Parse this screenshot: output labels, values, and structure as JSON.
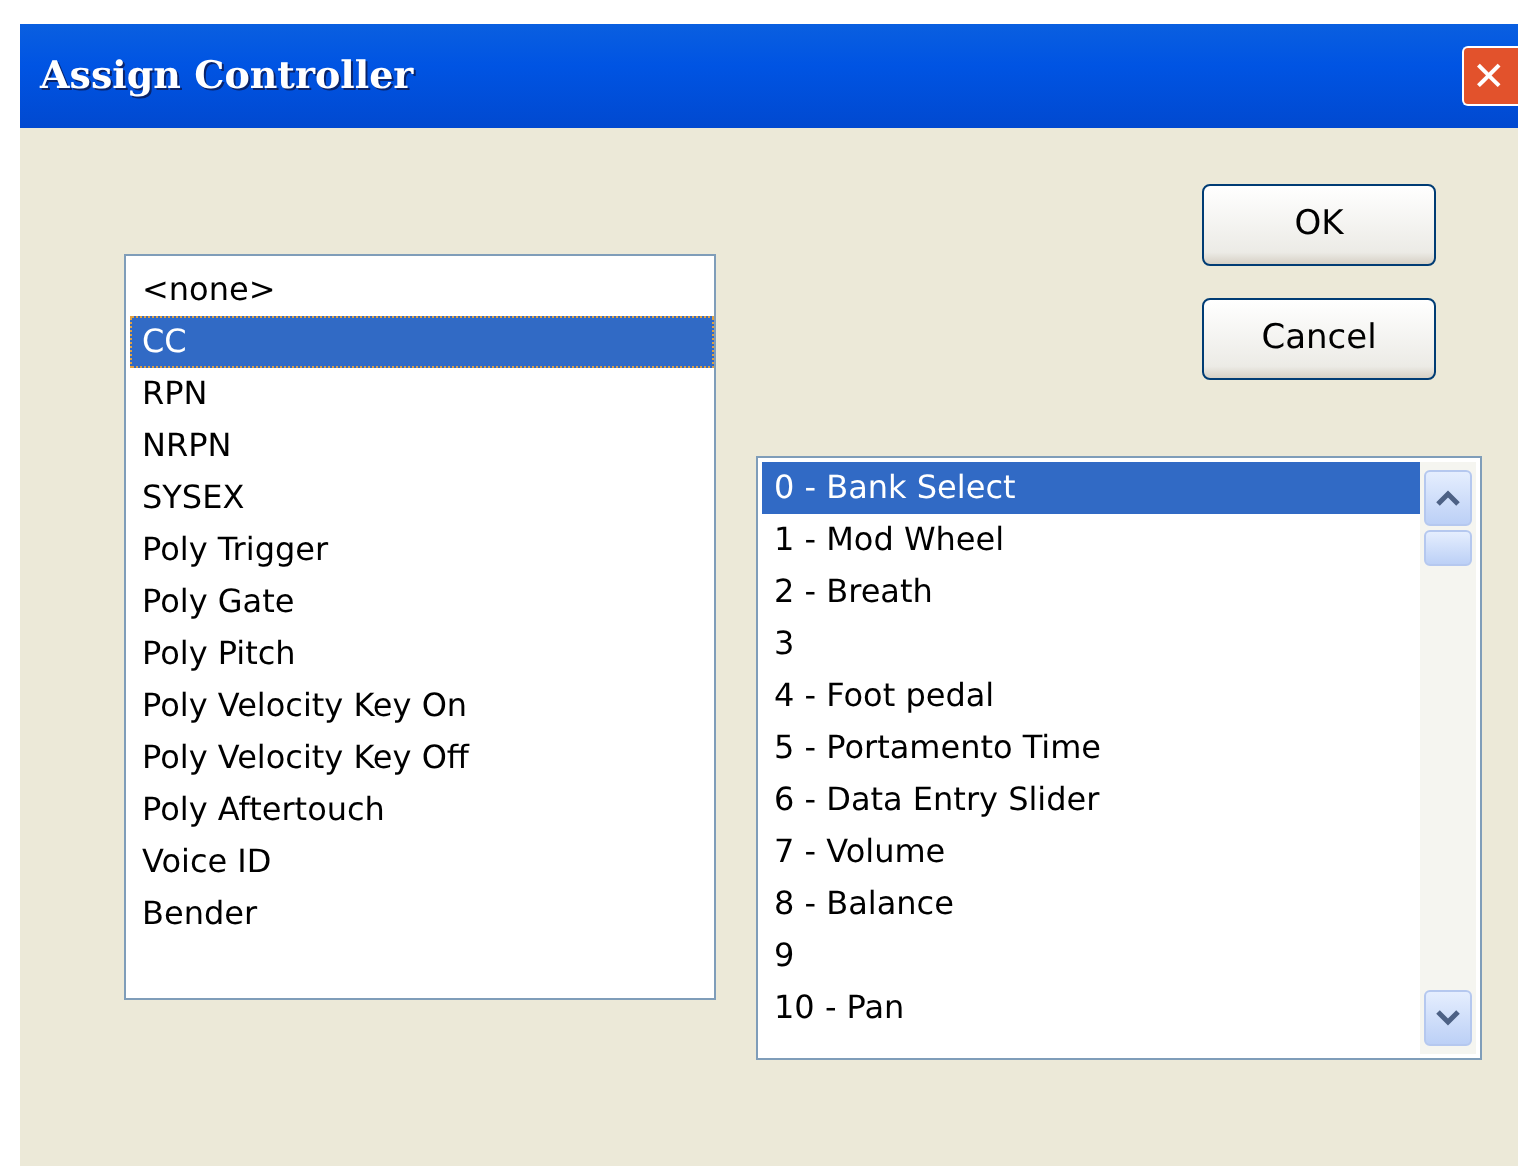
{
  "window": {
    "title": "Assign Controller",
    "close": "✕"
  },
  "buttons": [
    "OK",
    "Cancel"
  ],
  "type_list": [
    {
      "label": "<none>",
      "selected": false
    },
    {
      "label": "CC",
      "selected": true
    },
    {
      "label": "RPN",
      "selected": false
    },
    {
      "label": "NRPN",
      "selected": false
    },
    {
      "label": "SYSEX",
      "selected": false
    },
    {
      "label": "Poly Trigger",
      "selected": false
    },
    {
      "label": "Poly Gate",
      "selected": false
    },
    {
      "label": "Poly Pitch",
      "selected": false
    },
    {
      "label": "Poly Velocity Key On",
      "selected": false
    },
    {
      "label": "Poly Velocity Key Off",
      "selected": false
    },
    {
      "label": "Poly Aftertouch",
      "selected": false
    },
    {
      "label": "Voice ID",
      "selected": false
    },
    {
      "label": "Bender",
      "selected": false
    }
  ],
  "controller_list": [
    {
      "label": "0 - Bank Select",
      "selected": true
    },
    {
      "label": "1 - Mod Wheel",
      "selected": false
    },
    {
      "label": "2 - Breath",
      "selected": false
    },
    {
      "label": "3",
      "selected": false
    },
    {
      "label": "4 - Foot pedal",
      "selected": false
    },
    {
      "label": "5 - Portamento Time",
      "selected": false
    },
    {
      "label": "6 - Data Entry Slider",
      "selected": false
    },
    {
      "label": "7 - Volume",
      "selected": false
    },
    {
      "label": "8 - Balance",
      "selected": false
    },
    {
      "label": "9",
      "selected": false
    },
    {
      "label": "10 - Pan",
      "selected": false
    }
  ]
}
